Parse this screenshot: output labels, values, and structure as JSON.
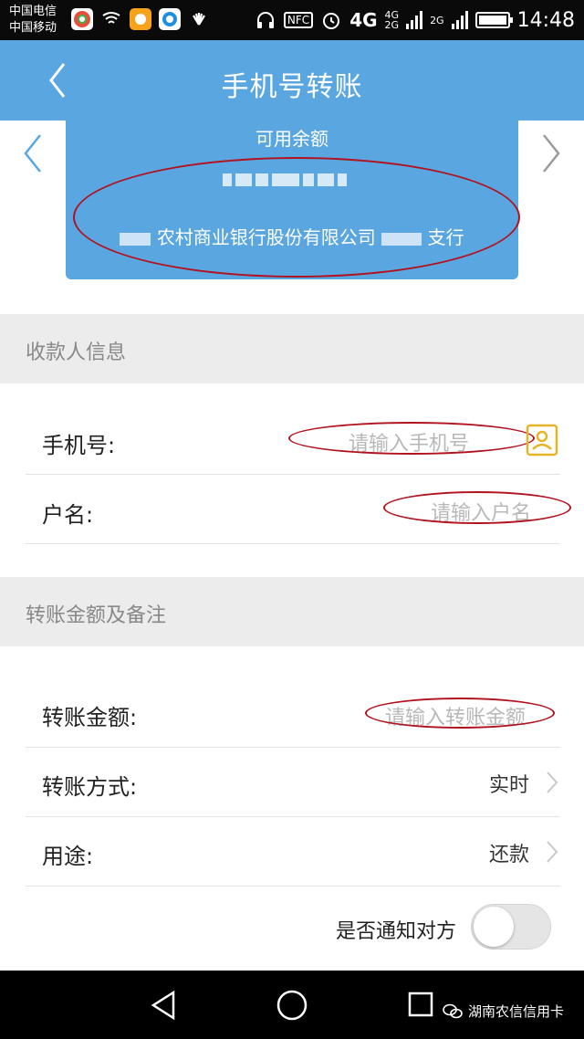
{
  "status_bar": {
    "carrier_1": "中国电信",
    "carrier_2": "中国移动",
    "nfc": "NFC",
    "net_4g": "4G",
    "net_4g_small": "4G",
    "net_2g_small": "2G",
    "net_2g": "2G",
    "time": "14:48"
  },
  "header": {
    "title": "手机号转账"
  },
  "account_card": {
    "label": "可用余额",
    "bank_name": "农村商业银行股份有限公司",
    "branch_suffix": "支行"
  },
  "payee_section": {
    "heading": "收款人信息",
    "phone_label": "手机号:",
    "phone_placeholder": "请输入手机号",
    "name_label": "户名:",
    "name_placeholder": "请输入户名"
  },
  "amount_section": {
    "heading": "转账金额及备注",
    "amount_label": "转账金额:",
    "amount_placeholder": "请输入转账金额",
    "method_label": "转账方式:",
    "method_value": "实时",
    "purpose_label": "用途:",
    "purpose_value": "还款",
    "notify_label": "是否通知对方",
    "notify_on": false
  },
  "watermark": {
    "text": "湖南农信信用卡"
  },
  "colors": {
    "header_blue": "#5aa6e0",
    "annotation_red": "#b1121e"
  }
}
